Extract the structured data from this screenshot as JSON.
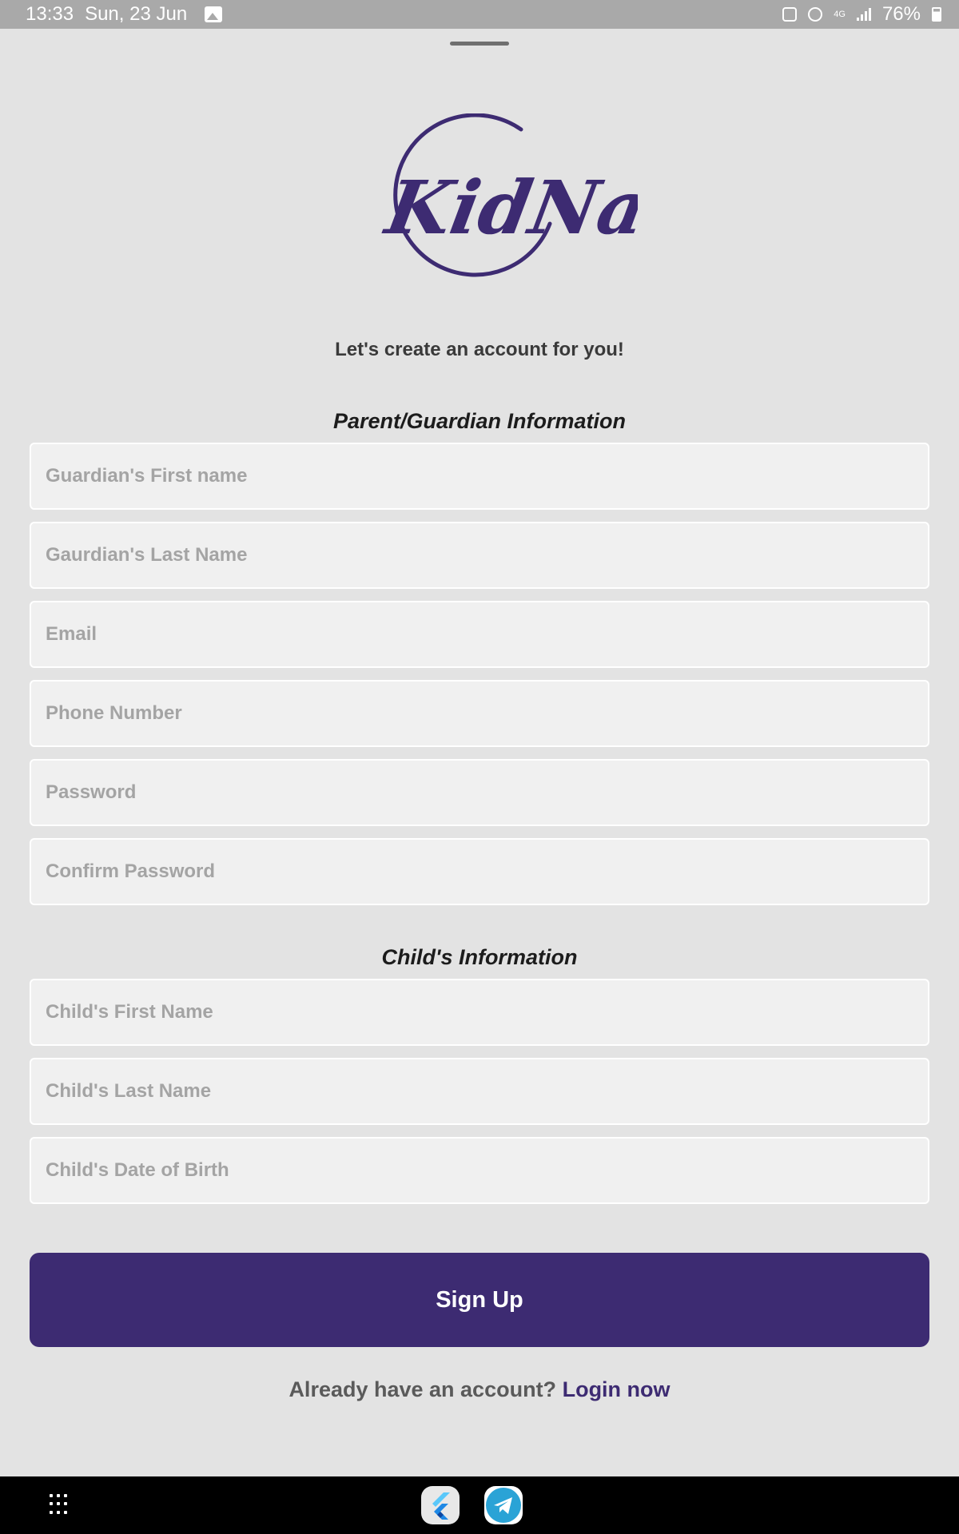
{
  "status_bar": {
    "time": "13:33",
    "date": "Sun, 23 Jun",
    "network": "4G",
    "battery": "76%",
    "icons": [
      "gallery-icon",
      "sim-icon",
      "alarm-icon",
      "network-4g-icon",
      "signal-icon",
      "battery-charging-icon"
    ]
  },
  "logo": {
    "text": "KidNav",
    "color": "#3d2b72"
  },
  "subtitle": "Let's create an account for you!",
  "guardian_section": {
    "title": "Parent/Guardian Information",
    "fields": {
      "first_name": "Guardian's First name",
      "last_name": "Gaurdian's Last Name",
      "email": "Email",
      "phone": "Phone Number",
      "password": "Password",
      "confirm_password": "Confirm Password"
    }
  },
  "child_section": {
    "title": "Child's Information",
    "fields": {
      "first_name": "Child's First Name",
      "last_name": "Child's Last Name",
      "dob": "Child's Date of Birth"
    }
  },
  "signup_button": {
    "label": "Sign Up",
    "color": "#3d2b72"
  },
  "login_prompt": {
    "text": "Already have an account?",
    "link": "Login now"
  },
  "nav_bar": {
    "icons": [
      "apps-grid-icon",
      "flutter-app-icon",
      "telegram-app-icon"
    ]
  }
}
